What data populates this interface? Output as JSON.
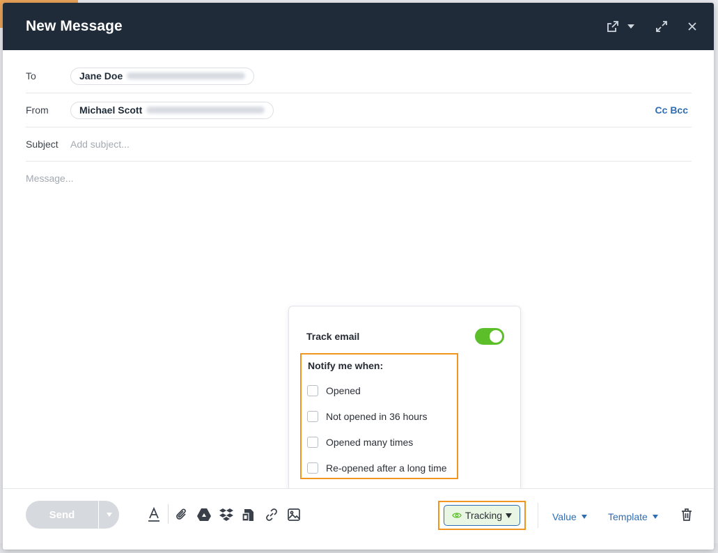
{
  "header": {
    "title": "New Message"
  },
  "to": {
    "label": "To",
    "name": "Jane Doe"
  },
  "from": {
    "label": "From",
    "name": "Michael Scott",
    "cc_bcc": "Cc Bcc"
  },
  "subject": {
    "label": "Subject",
    "placeholder": "Add subject..."
  },
  "message": {
    "placeholder": "Message..."
  },
  "tracking_popover": {
    "track_label": "Track email",
    "track_enabled": true,
    "notify_title": "Notify me when:",
    "options": [
      {
        "label": "Opened",
        "checked": false
      },
      {
        "label": "Not opened in 36 hours",
        "checked": false
      },
      {
        "label": "Opened many times",
        "checked": false
      },
      {
        "label": "Re-opened after a long time",
        "checked": false
      }
    ]
  },
  "footer": {
    "send_label": "Send",
    "tracking_label": "Tracking",
    "value_label": "Value",
    "template_label": "Template",
    "tools": [
      "text-format-icon",
      "attachment-icon",
      "google-drive-icon",
      "dropbox-icon",
      "document-library-icon",
      "link-icon",
      "image-icon"
    ]
  },
  "colors": {
    "header_bg": "#1f2b38",
    "link_blue": "#2f6db3",
    "toggle_green": "#5cbf2a",
    "highlight_orange": "#f0961e"
  }
}
